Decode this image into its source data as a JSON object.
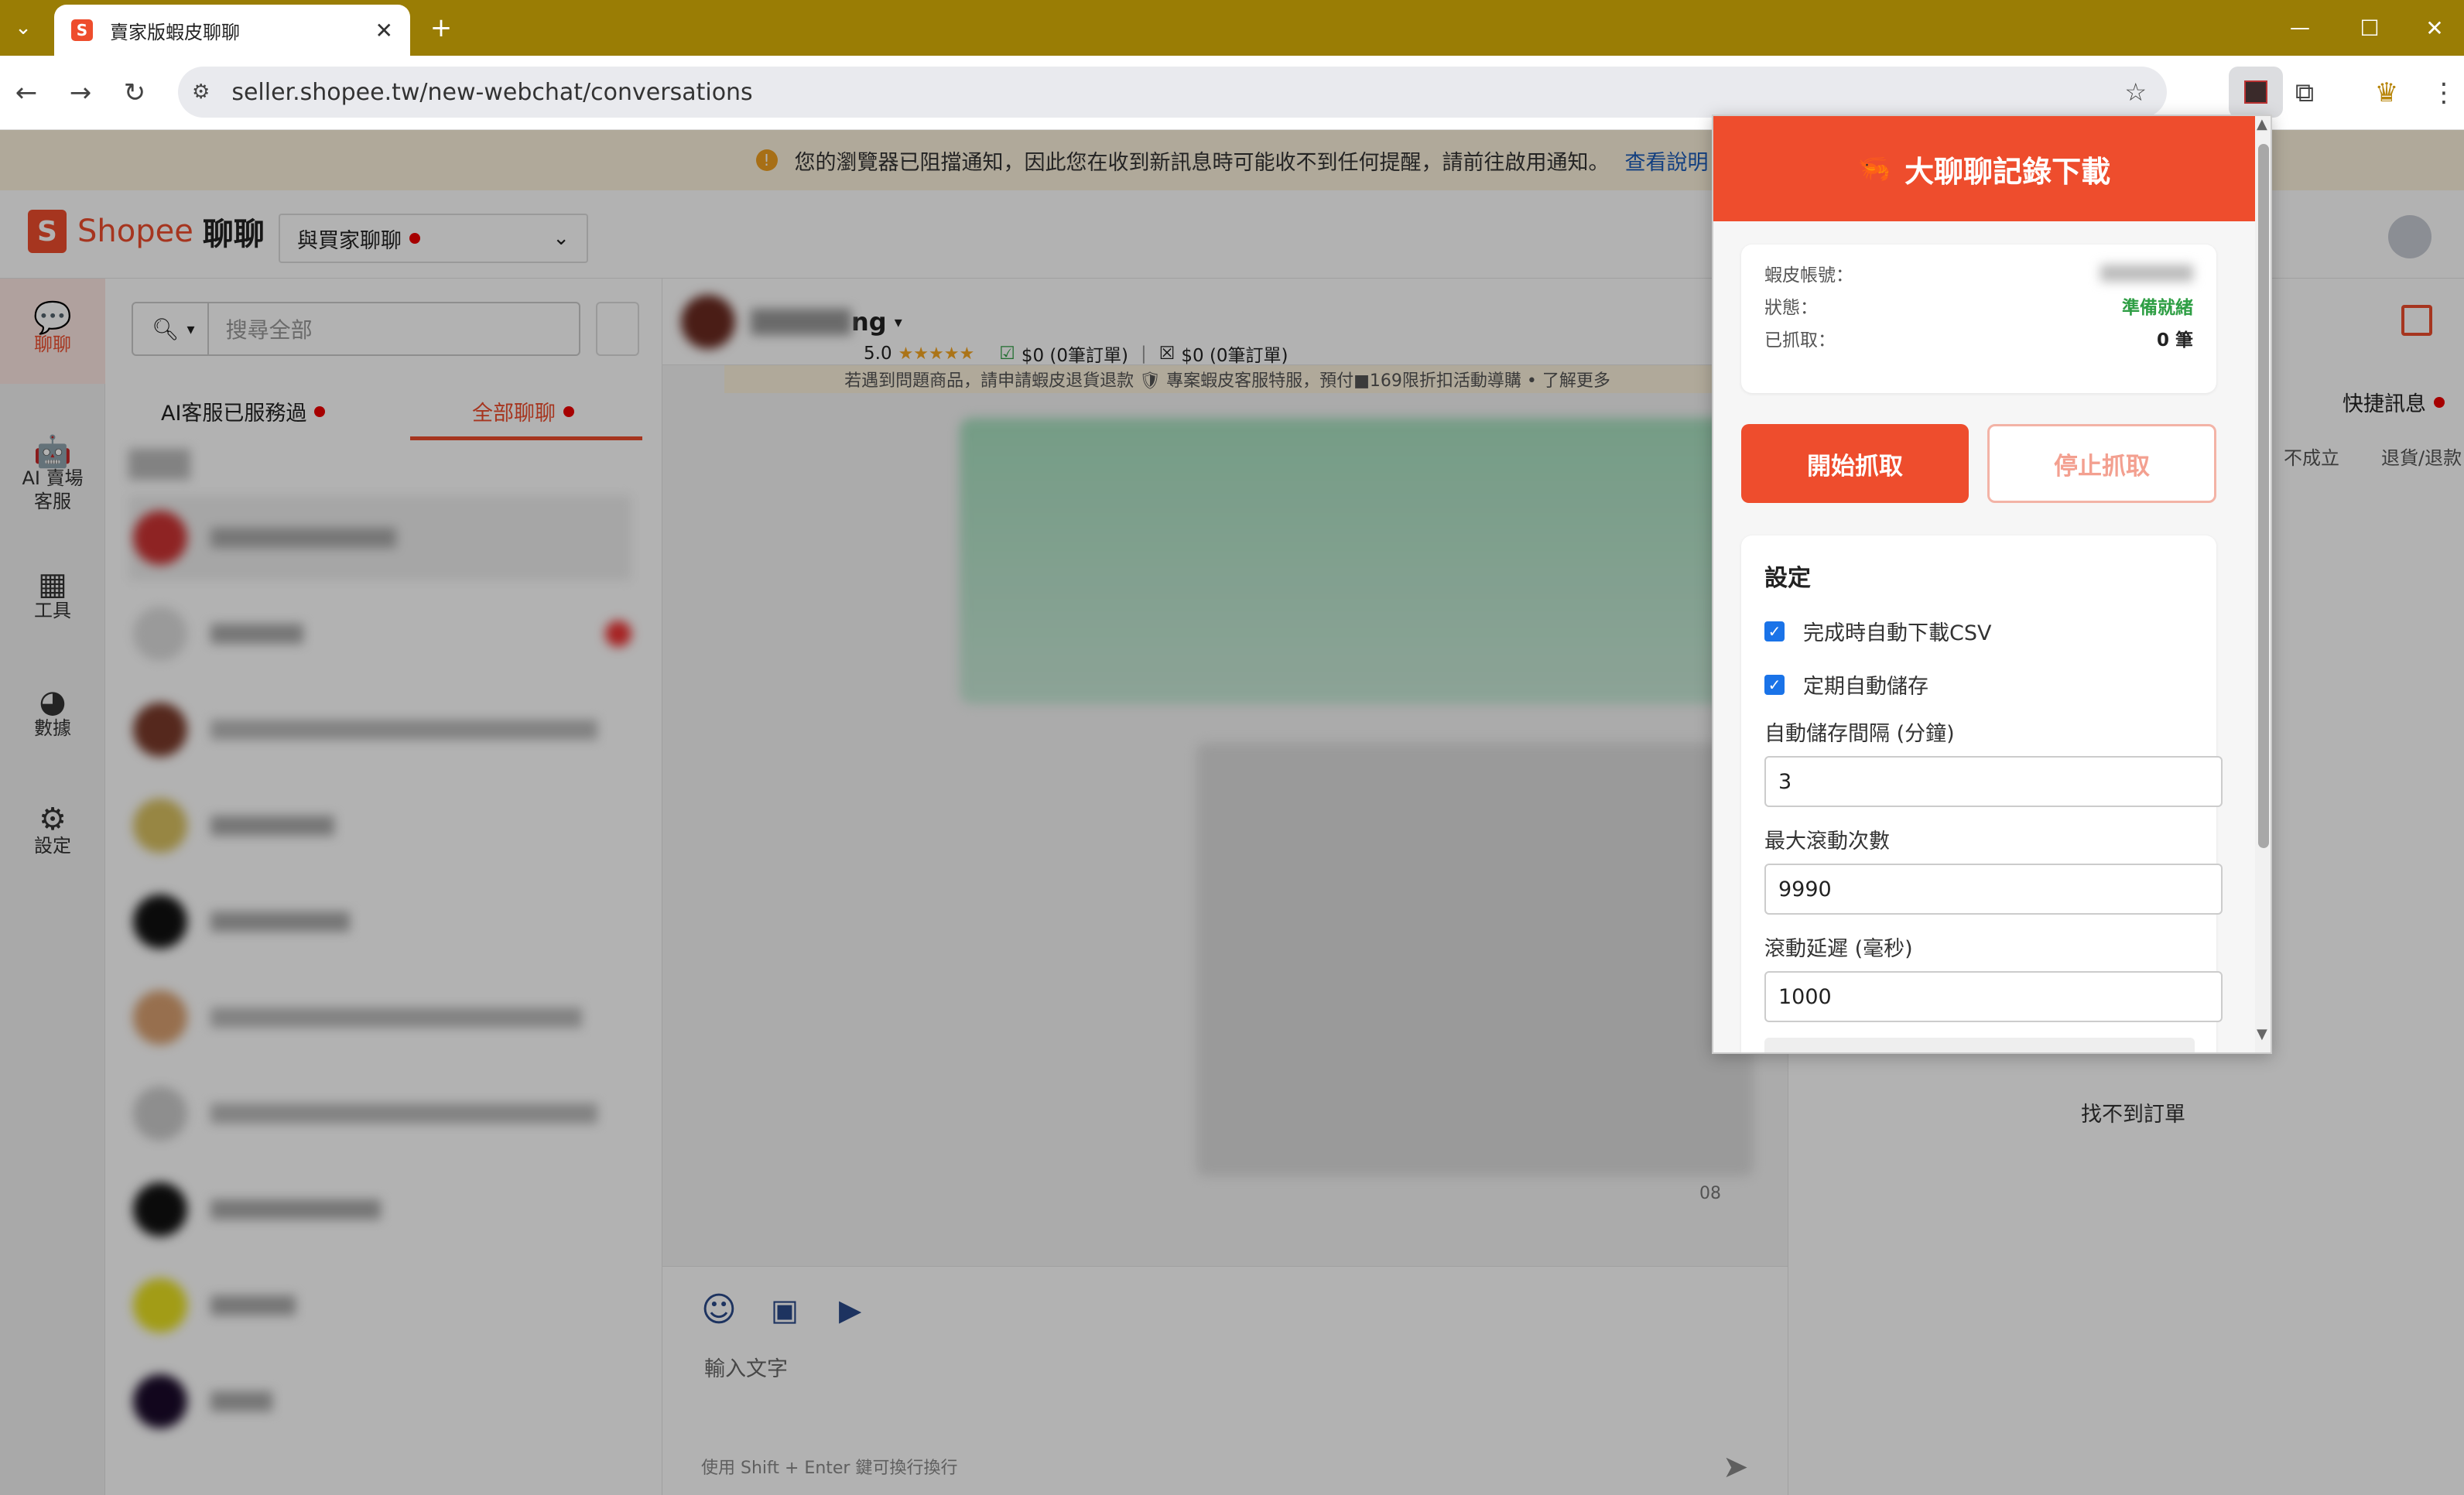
{
  "browser": {
    "tab_title": "賣家版蝦皮聊聊",
    "url": "seller.shopee.tw/new-webchat/conversations"
  },
  "page": {
    "notification": "您的瀏覽器已阻擋通知，因此您在收到新訊息時可能收不到任何提醒，請前往啟用通知。",
    "notification_link": "查看說明",
    "logo_text": "Shopee",
    "logo_sub": "聊聊",
    "chat_mode_select": "與買家聊聊",
    "nav": [
      {
        "label": "聊聊",
        "icon": "chat-icon"
      },
      {
        "label": "AI 賣場\n客服",
        "icon": "ai-bot-icon"
      },
      {
        "label": "工具",
        "icon": "tools-icon"
      },
      {
        "label": "數據",
        "icon": "pie-chart-icon"
      },
      {
        "label": "設定",
        "icon": "gear-icon"
      }
    ],
    "search_placeholder": "搜尋全部",
    "filter_tabs": [
      "AI客服已服務過",
      "全部聊聊"
    ],
    "buyer_name_suffix": "ng",
    "buyer_rating": "5.0",
    "stat1": "$0 (0筆訂單)",
    "stat2": "$0 (0筆訂單)",
    "chat_banner": "若遇到問題商品，請申請蝦皮退貨退款 🛡 專案蝦皮客服特服，預付■169限折扣活動導購 • 了解更多",
    "message_time": "08",
    "input_placeholder": "輸入文字",
    "input_hint": "使用 Shift + Enter 鍵可換行換行",
    "quick_reply": "快捷訊息",
    "order_tabs": [
      "不成立",
      "退貨/退款"
    ],
    "no_orders": "找不到訂單"
  },
  "popup": {
    "title": "大聊聊記錄下載",
    "account_label": "蝦皮帳號：",
    "status_label": "狀態：",
    "status_value": "準備就緒",
    "fetched_label": "已抓取：",
    "fetched_value": "0 筆",
    "start_button": "開始抓取",
    "stop_button": "停止抓取",
    "settings_title": "設定",
    "opt_auto_csv": "完成時自動下載CSV",
    "opt_auto_save": "定期自動儲存",
    "interval_label": "自動儲存間隔 (分鐘)",
    "interval_value": "3",
    "max_scroll_label": "最大滾動次數",
    "max_scroll_value": "9990",
    "scroll_delay_label": "滾動延遲 (毫秒)",
    "scroll_delay_value": "1000"
  },
  "colors": {
    "brand": "#ee4d2d",
    "status_ready": "#2e9e44",
    "chrome_frame": "#9a7d05",
    "checkbox": "#1a73e8"
  }
}
